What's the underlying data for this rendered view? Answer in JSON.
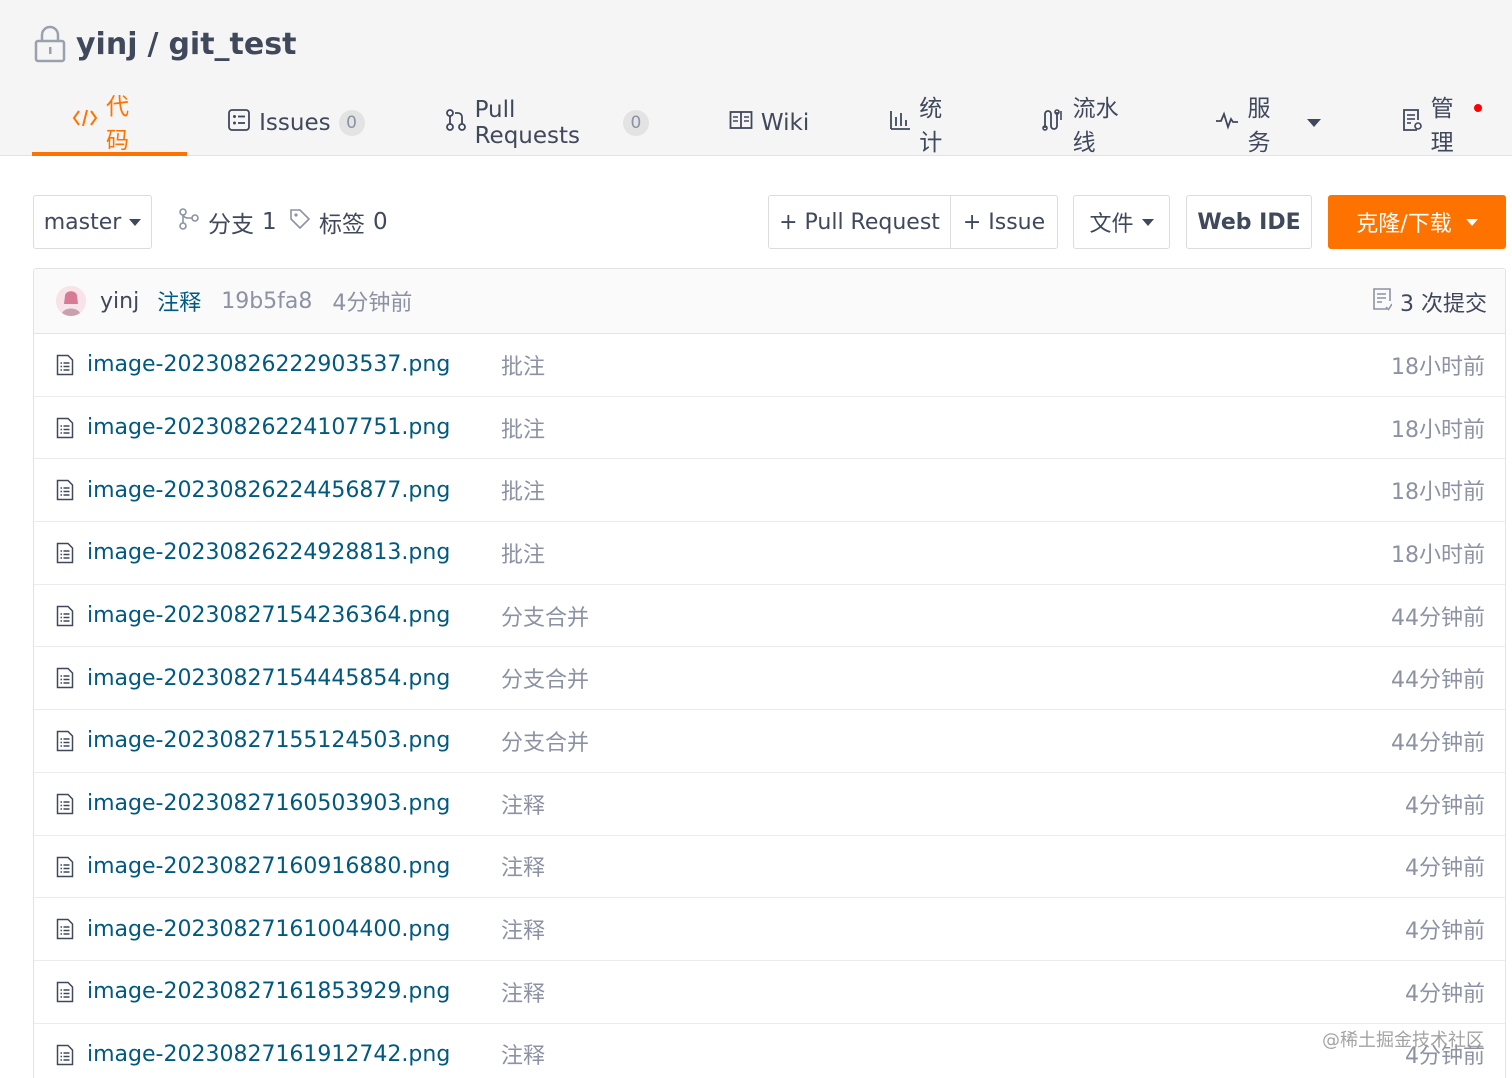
{
  "repo": {
    "owner": "yinj",
    "separator": "/",
    "name": "git_test"
  },
  "tabs": [
    {
      "label": "代码",
      "icon": "code-icon",
      "active": true
    },
    {
      "label": "Issues",
      "icon": "issues-icon",
      "count": "0"
    },
    {
      "label": "Pull Requests",
      "icon": "pull-request-icon",
      "count": "0"
    },
    {
      "label": "Wiki",
      "icon": "wiki-icon"
    },
    {
      "label": "统计",
      "icon": "chart-icon"
    },
    {
      "label": "流水线",
      "icon": "pipeline-icon"
    },
    {
      "label": "服务",
      "icon": "pulse-icon"
    },
    {
      "label": "管理",
      "icon": "manage-icon"
    }
  ],
  "toolbar": {
    "branch_select": "master",
    "branches_label": "分支",
    "branches_count": "1",
    "tags_label": "标签",
    "tags_count": "0",
    "new_pr": "+ Pull Request",
    "new_issue": "+ Issue",
    "file_menu": "文件",
    "web_ide": "Web IDE",
    "clone": "克隆/下载"
  },
  "colors": {
    "accent": "#fe7300",
    "link": "#005980",
    "muted": "#8c92a4"
  },
  "commit": {
    "author": "yinj",
    "message": "注释",
    "hash": "19b5fa8",
    "time": "4分钟前",
    "count_label": "3 次提交"
  },
  "files": [
    {
      "name": "image-20230826222903537.png",
      "message": "批注",
      "time": "18小时前"
    },
    {
      "name": "image-20230826224107751.png",
      "message": "批注",
      "time": "18小时前"
    },
    {
      "name": "image-20230826224456877.png",
      "message": "批注",
      "time": "18小时前"
    },
    {
      "name": "image-20230826224928813.png",
      "message": "批注",
      "time": "18小时前"
    },
    {
      "name": "image-20230827154236364.png",
      "message": "分支合并",
      "time": "44分钟前"
    },
    {
      "name": "image-20230827154445854.png",
      "message": "分支合并",
      "time": "44分钟前"
    },
    {
      "name": "image-20230827155124503.png",
      "message": "分支合并",
      "time": "44分钟前"
    },
    {
      "name": "image-20230827160503903.png",
      "message": "注释",
      "time": "4分钟前"
    },
    {
      "name": "image-20230827160916880.png",
      "message": "注释",
      "time": "4分钟前"
    },
    {
      "name": "image-20230827161004400.png",
      "message": "注释",
      "time": "4分钟前"
    },
    {
      "name": "image-20230827161853929.png",
      "message": "注释",
      "time": "4分钟前"
    },
    {
      "name": "image-20230827161912742.png",
      "message": "注释",
      "time": "4分钟前"
    }
  ],
  "watermark": "@稀土掘金技术社区"
}
